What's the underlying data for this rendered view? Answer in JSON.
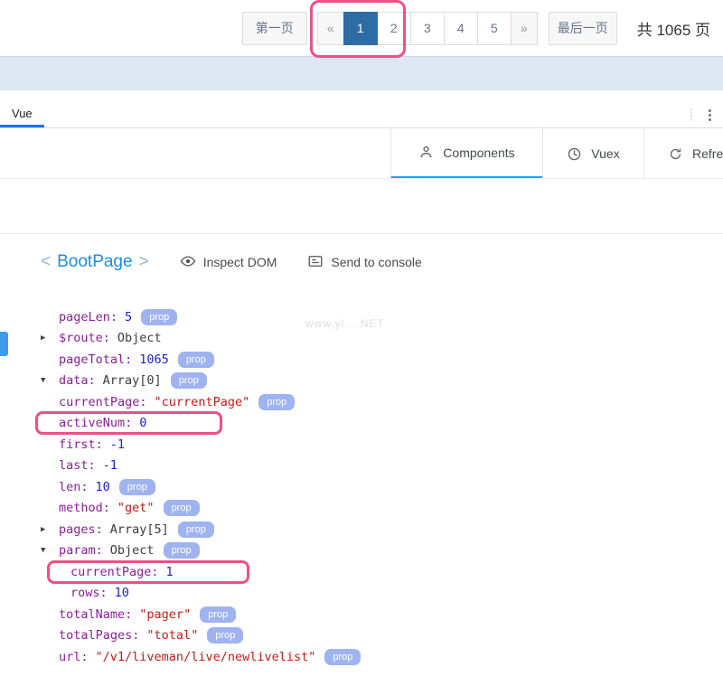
{
  "pagination": {
    "first_label": "第一页",
    "prev_label": "«",
    "pages": [
      "1",
      "2",
      "3",
      "4",
      "5"
    ],
    "active_page": "1",
    "next_label": "»",
    "last_label": "最后一页",
    "total_label": "共 1065 页"
  },
  "devtools": {
    "panel_tab": "Vue",
    "divider_icon": "┊",
    "overflow_menu_icon": "⋮",
    "tabs": [
      {
        "label": "Components",
        "icon": "components-icon",
        "active": true
      },
      {
        "label": "Vuex",
        "icon": "vuex-icon",
        "active": false
      },
      {
        "label": "Refresh",
        "icon": "refresh-icon",
        "active": false
      }
    ]
  },
  "inspector": {
    "component_open": "<",
    "component_name": "BootPage",
    "component_close": ">",
    "inspect_dom_label": "Inspect DOM",
    "send_to_console_label": "Send to console",
    "watermark": "www.yl….NET",
    "colors": {
      "highlight_pink": "#ef4f86",
      "active_page_blue": "#2d6ca4",
      "badge_blue": "#9fb3f0",
      "key_purple": "#8a1e9b",
      "number_blue": "#1a21cc",
      "string_red": "#c41a16",
      "tab_underline_blue": "#2aa0f2"
    },
    "props": [
      {
        "key": "pageLen",
        "value": "5",
        "type": "number",
        "badge": "prop"
      },
      {
        "key": "$route",
        "value": "Object",
        "type": "object",
        "arrow": "collapsed"
      },
      {
        "key": "pageTotal",
        "value": "1065",
        "type": "number",
        "badge": "prop"
      },
      {
        "key": "data",
        "value": "Array[0]",
        "type": "object",
        "arrow": "expanded",
        "badge": "prop"
      },
      {
        "key": "currentPage",
        "value": "\"currentPage\"",
        "type": "string",
        "badge": "prop"
      },
      {
        "key": "activeNum",
        "value": "0",
        "type": "number",
        "highlight": true
      },
      {
        "key": "first",
        "value": "-1",
        "type": "number"
      },
      {
        "key": "last",
        "value": "-1",
        "type": "number"
      },
      {
        "key": "len",
        "value": "10",
        "type": "number",
        "badge": "prop"
      },
      {
        "key": "method",
        "value": "\"get\"",
        "type": "string",
        "badge": "prop"
      },
      {
        "key": "pages",
        "value": "Array[5]",
        "type": "object",
        "arrow": "collapsed",
        "badge": "prop"
      },
      {
        "key": "param",
        "value": "Object",
        "type": "object",
        "arrow": "expanded",
        "badge": "prop"
      },
      {
        "key": "currentPage",
        "value": "1",
        "type": "number",
        "indent": 1,
        "highlight": true
      },
      {
        "key": "rows",
        "value": "10",
        "type": "number",
        "indent": 1
      },
      {
        "key": "totalName",
        "value": "\"pager\"",
        "type": "string",
        "badge": "prop"
      },
      {
        "key": "totalPages",
        "value": "\"total\"",
        "type": "string",
        "badge": "prop"
      },
      {
        "key": "url",
        "value": "\"/v1/liveman/live/newlivelist\"",
        "type": "string",
        "badge": "prop"
      }
    ]
  }
}
